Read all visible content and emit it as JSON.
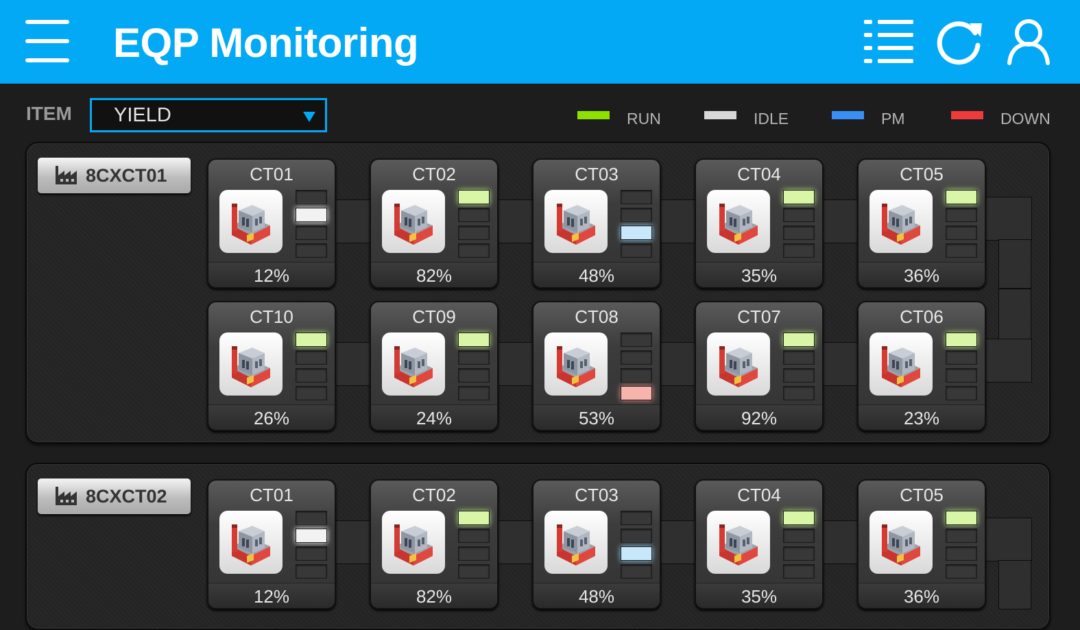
{
  "header": {
    "title": "EQP Monitoring",
    "icons": [
      "menu-icon",
      "list-icon",
      "refresh-icon",
      "user-icon"
    ],
    "bg_color": "#03a9f4"
  },
  "filter": {
    "label": "ITEM",
    "selected": "YIELD"
  },
  "legend": [
    {
      "label": "RUN",
      "color": "#8ee000"
    },
    {
      "label": "IDLE",
      "color": "#d8d8d8"
    },
    {
      "label": "PM",
      "color": "#3a8ff5"
    },
    {
      "label": "DOWN",
      "color": "#ef3b3b"
    }
  ],
  "lines": [
    {
      "name": "8CXCT01",
      "rows": [
        [
          {
            "name": "CT01",
            "value": "12%",
            "status": "IDLE"
          },
          {
            "name": "CT02",
            "value": "82%",
            "status": "RUN"
          },
          {
            "name": "CT03",
            "value": "48%",
            "status": "PM"
          },
          {
            "name": "CT04",
            "value": "35%",
            "status": "RUN"
          },
          {
            "name": "CT05",
            "value": "36%",
            "status": "RUN"
          }
        ],
        [
          {
            "name": "CT10",
            "value": "26%",
            "status": "RUN"
          },
          {
            "name": "CT09",
            "value": "24%",
            "status": "RUN"
          },
          {
            "name": "CT08",
            "value": "53%",
            "status": "DOWN"
          },
          {
            "name": "CT07",
            "value": "92%",
            "status": "RUN"
          },
          {
            "name": "CT06",
            "value": "23%",
            "status": "RUN"
          }
        ]
      ]
    },
    {
      "name": "8CXCT02",
      "rows": [
        [
          {
            "name": "CT01",
            "value": "12%",
            "status": "IDLE"
          },
          {
            "name": "CT02",
            "value": "82%",
            "status": "RUN"
          },
          {
            "name": "CT03",
            "value": "48%",
            "status": "PM"
          },
          {
            "name": "CT04",
            "value": "35%",
            "status": "RUN"
          },
          {
            "name": "CT05",
            "value": "36%",
            "status": "RUN"
          }
        ]
      ]
    }
  ]
}
